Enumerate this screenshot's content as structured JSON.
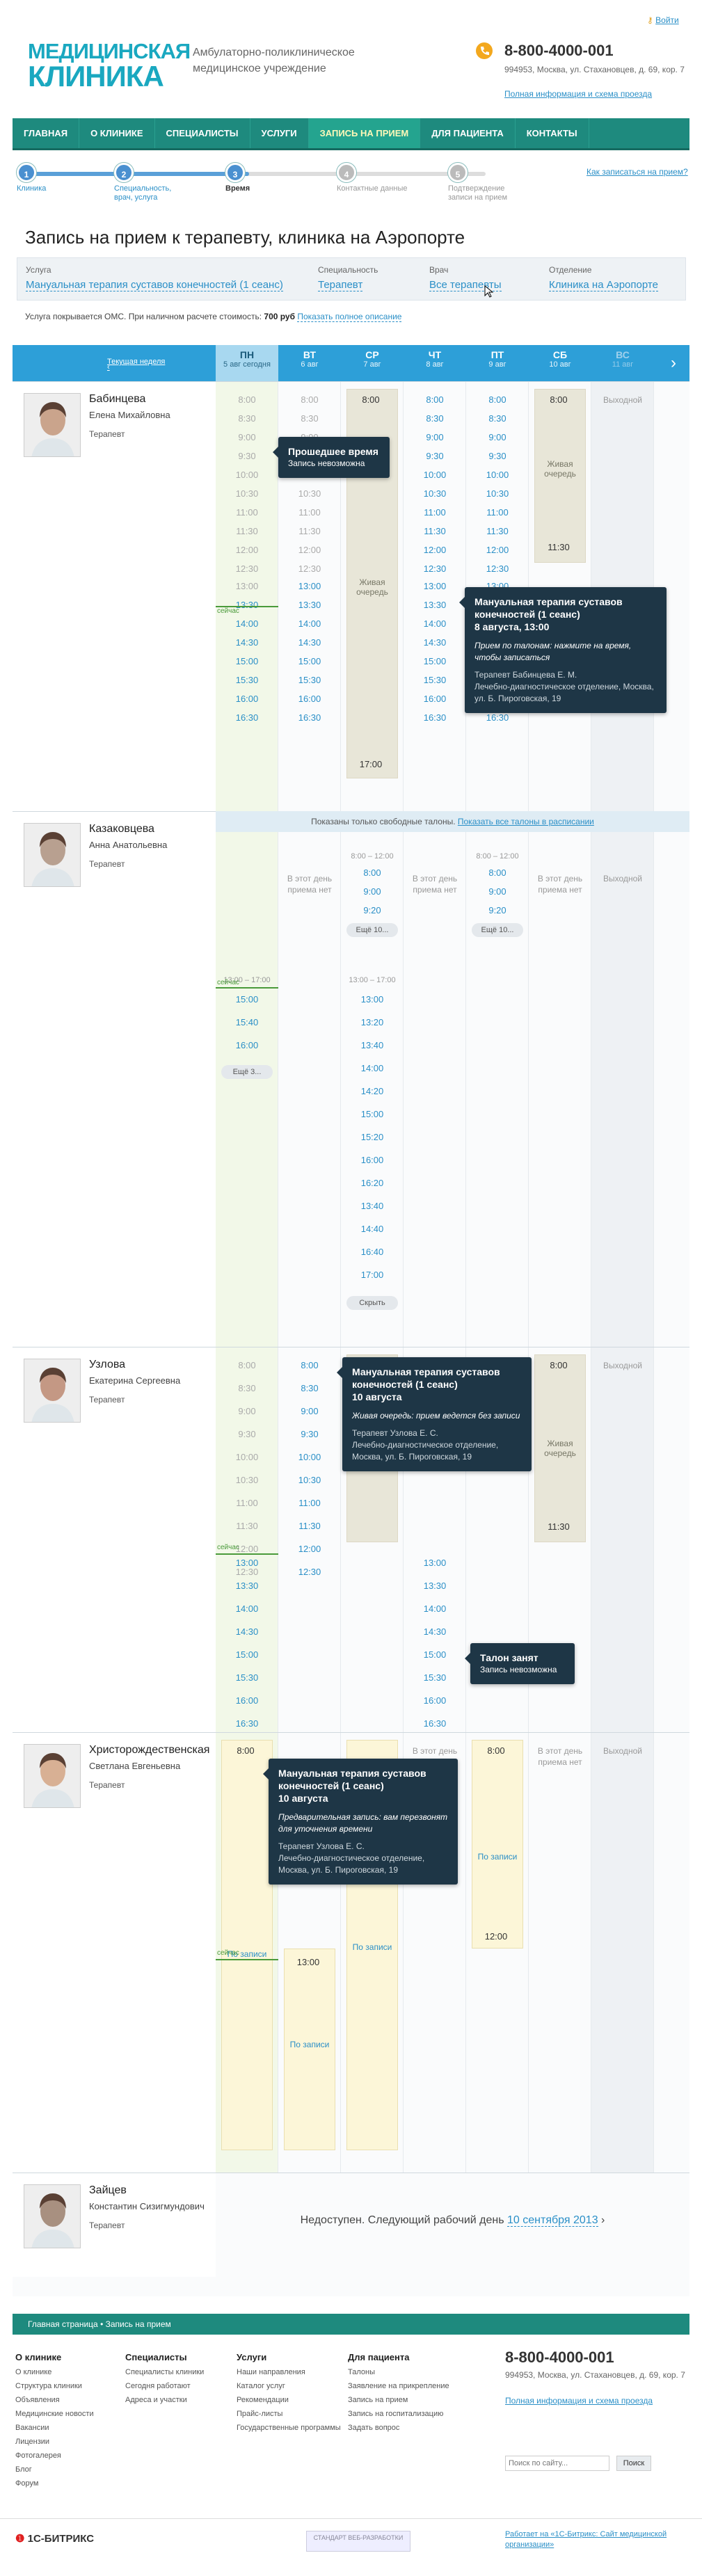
{
  "header": {
    "login": "Войти",
    "logo_line1": "МЕДИЦИНСКАЯ",
    "logo_line2": "КЛИНИКА",
    "tagline": "Амбулаторно-поликлиническое медицинское учреждение",
    "phone": "8-800-4000-001",
    "address": "994953, Москва, ул. Стахановцев, д. 69, кор. 7",
    "full_info": "Полная информация и схема проезда"
  },
  "nav": [
    "ГЛАВНАЯ",
    "О КЛИНИКЕ",
    "СПЕЦИАЛИСТЫ",
    "УСЛУГИ",
    "ЗАПИСЬ НА ПРИЕМ",
    "ДЛЯ ПАЦИЕНТА",
    "КОНТАКТЫ"
  ],
  "steps": [
    {
      "n": "1",
      "t": "Клиника"
    },
    {
      "n": "2",
      "t": "Специальность, врач, услуга"
    },
    {
      "n": "3",
      "t": "Время"
    },
    {
      "n": "4",
      "t": "Контактные данные"
    },
    {
      "n": "5",
      "t": "Подтверждение записи на прием"
    }
  ],
  "howto": "Как записаться на прием?",
  "title": "Запись на прием к терапевту, клиника на Аэропорте",
  "selection": [
    {
      "k": "Услуга",
      "v": "Мануальная терапия суставов конечностей (1 сеанс)"
    },
    {
      "k": "Специальность",
      "v": "Терапевт"
    },
    {
      "k": "Врач",
      "v": "Все терапевты"
    },
    {
      "k": "Отделение",
      "v": "Клиника на Аэропорте"
    }
  ],
  "oms": {
    "text": "Услуга покрывается ОМС. При наличном расчете стоимость:",
    "price": "700 руб",
    "link": "Показать полное описание"
  },
  "header_row": {
    "current_week": "Текущая неделя",
    "days": [
      {
        "d": "ПН",
        "dt": "5 авг сегодня"
      },
      {
        "d": "ВТ",
        "dt": "6 авг"
      },
      {
        "d": "СР",
        "dt": "7 авг"
      },
      {
        "d": "ЧТ",
        "dt": "8 авг"
      },
      {
        "d": "ПТ",
        "dt": "9 авг"
      },
      {
        "d": "СБ",
        "dt": "10 авг"
      },
      {
        "d": "ВС",
        "dt": "11 авг"
      }
    ]
  },
  "labels": {
    "now": "сейчас",
    "no_day": "В этот день приема нет",
    "off": "Выходной",
    "live": "Живая очередь",
    "by_record": "По записи",
    "more": "Ещё 3...",
    "more10": "Ещё 10...",
    "hide": "Скрыть"
  },
  "doctors": [
    {
      "name": "Бабинцева",
      "patronymic": "Елена Михайловна",
      "spec": "Терапевт"
    },
    {
      "name": "Казаковцева",
      "patronymic": "Анна Анатольевна",
      "spec": "Терапевт"
    },
    {
      "name": "Узлова",
      "patronymic": "Екатерина Сергеевна",
      "spec": "Терапевт"
    },
    {
      "name": "Христорождественская",
      "patronymic": "Светлана Евгеньевна",
      "spec": "Терапевт"
    },
    {
      "name": "Зайцев",
      "patronymic": "Константин Сизигмундович",
      "spec": "Терапевт"
    }
  ],
  "band": {
    "text": "Показаны только свободные талоны.",
    "link": "Показать все талоны в расписании"
  },
  "unavailable": {
    "text": "Недоступен. Следующий рабочий день",
    "link": "10 сентября 2013"
  },
  "tips": {
    "past": {
      "t": "Прошедшее время",
      "s": "Запись невозможна"
    },
    "t1": {
      "t": "Мануальная терапия суставов конечностей (1 сеанс)",
      "d": "8 августа, 13:00",
      "a": "Прием по талонам: нажмите на время, чтобы записаться",
      "doc": "Терапевт Бабинцева Е. М.",
      "dep": "Лечебно-диагностическое отделение, Москва, ул. Б. Пироговская, 19"
    },
    "t2": {
      "t": "Мануальная терапия суставов конечностей (1 сеанс)",
      "d": "10 августа",
      "a": "Живая очередь: прием ведется без записи",
      "doc": "Терапевт Узлова Е. С.",
      "dep": "Лечебно-диагностическое отделение, Москва, ул. Б. Пироговская, 19"
    },
    "busy": {
      "t": "Талон занят",
      "s": "Запись невозможна"
    },
    "t3": {
      "t": "Мануальная терапия суставов конечностей (1 сеанс)",
      "d": "10 августа",
      "a": "Предварительная запись: вам перезвонят для уточнения времени",
      "doc": "Терапевт Узлова Е. С.",
      "dep": "Лечебно-диагностическое отделение, Москва, ул. Б. Пироговская, 19"
    }
  },
  "footer": {
    "crumb": "Главная страница • Запись на прием",
    "cols": [
      {
        "h": "О клинике",
        "items": [
          "О клинике",
          "Структура клиники",
          "Объявления",
          "Медицинские новости",
          "Вакансии",
          "Лицензии",
          "Фотогалерея",
          "Блог",
          "Форум"
        ]
      },
      {
        "h": "Специалисты",
        "items": [
          "Специалисты клиники",
          "Сегодня работают",
          "Адреса и участки"
        ]
      },
      {
        "h": "Услуги",
        "items": [
          "Наши направления",
          "Каталог услуг",
          "Рекомендации",
          "Прайс-листы",
          "Государственные программы"
        ]
      },
      {
        "h": "Для пациента",
        "items": [
          "Талоны",
          "Заявление на прикрепление",
          "Запись на прием",
          "Запись на госпитализацию",
          "Задать вопрос"
        ]
      }
    ],
    "phone": "8-800-4000-001",
    "address": "994953, Москва, ул. Стахановцев, д. 69, кор. 7",
    "full_info": "Полная информация и схема проезда",
    "search_ph": "Поиск по сайту...",
    "search_btn": "Поиск",
    "bitrix": "1С-БИТРИКС",
    "stamp": "СТАНДАРТ ВЕБ-РАЗРАБОТКИ",
    "made": "Работает на «1С-Битрикс: Сайт медицинской организации»"
  },
  "colors": {
    "teal": "#1e8a7e",
    "blue": "#2d9fd8",
    "tip": "#1e3646"
  }
}
